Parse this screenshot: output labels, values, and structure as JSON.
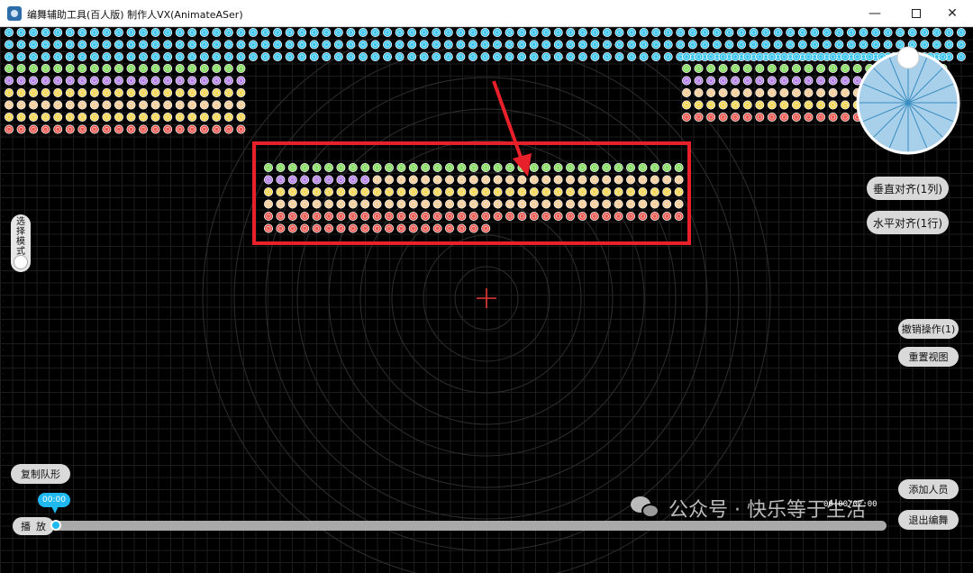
{
  "window": {
    "title": "编舞辅助工具(百人版)  制作人VX(AnimateASer)",
    "minimize_icon": "minimize-icon",
    "maximize_icon": "maximize-icon",
    "close_icon": "close-icon"
  },
  "colors": {
    "background": "#000000",
    "cyan": "#35c3ee",
    "green": "#7ed957",
    "purple": "#b07be6",
    "yellow": "#f3d34a",
    "peach": "#f4c891",
    "red": "#e8524a",
    "highlight": "#e8202a",
    "accent": "#20b8f0"
  },
  "left_panel": {
    "mode_toggle_label": "选择模式",
    "copy_formation": "复制队形"
  },
  "right_panel": {
    "align_vertical": "垂直对齐(1列)",
    "align_horizontal": "水平对齐(1行)",
    "undo": "撤销操作(1)",
    "reset_view": "重置视图",
    "add_person": "添加人员",
    "exit_choreo": "退出编舞"
  },
  "timeline": {
    "play_label": "播放",
    "current_time": "00:00",
    "total_time": "00:00/02:00",
    "progress": 0
  },
  "watermark": {
    "text": "公众号 · 快乐等于生活"
  },
  "dancers": {
    "icon": "dancer-face-icon",
    "selected_rows": [
      {
        "color": "green",
        "count": 35
      },
      {
        "color": "purple",
        "count": 9
      },
      {
        "color": "peach",
        "count": 26
      },
      {
        "color": "yellow",
        "count": 35
      },
      {
        "color": "red",
        "count": 35
      },
      {
        "color": "red",
        "count": 19
      }
    ]
  },
  "icons": {
    "center_marker": "crosshair-icon",
    "rotation_dial": "rotation-dial-icon",
    "annotation": "red-arrow-icon"
  }
}
